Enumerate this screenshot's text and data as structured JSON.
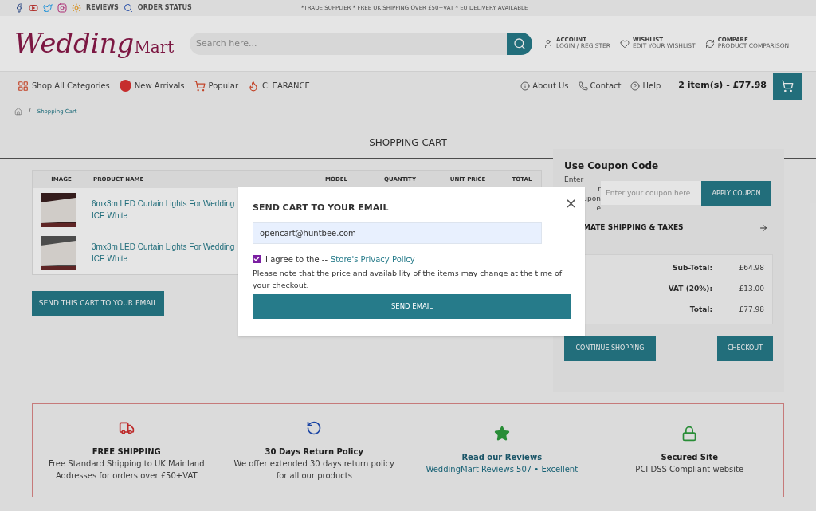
{
  "top_bar": {
    "links": [
      "REVIEWS",
      "ORDER STATUS"
    ],
    "notice": "*TRADE SUPPLIER * FREE UK SHIPPING OVER £50+VAT * EU DELIVERY AVAILABLE"
  },
  "header": {
    "logo": {
      "script": "Wedding",
      "word": "Mart"
    },
    "search": {
      "placeholder": "Search here..."
    },
    "account_links": [
      {
        "title": "ACCOUNT",
        "subtitle": "LOGIN / REGISTER"
      },
      {
        "title": "WISHLIST",
        "subtitle": "EDIT YOUR WISHLIST"
      },
      {
        "title": "COMPARE",
        "subtitle": "PRODUCT COMPARISON"
      }
    ]
  },
  "nav": {
    "items": [
      "Shop All Categories",
      "New Arrivals",
      "Popular",
      "CLEARANCE"
    ],
    "right_items": [
      "About Us",
      "Contact",
      "Help"
    ],
    "cart": "2 item(s) - £77.98"
  },
  "breadcrumb": {
    "separator": "/",
    "items": [
      "Shopping Cart"
    ]
  },
  "page_title": "SHOPPING CART",
  "cart_table": {
    "columns": [
      "IMAGE",
      "PRODUCT NAME",
      "MODEL",
      "QUANTITY",
      "UNIT PRICE",
      "TOTAL"
    ],
    "rows": [
      {
        "name": [
          "6mx3m LED Curtain Lights For Wedding",
          "ICE White"
        ]
      },
      {
        "name": [
          "3mx3m LED Curtain Lights For Wedding",
          "ICE White"
        ]
      }
    ]
  },
  "send_cart_button": "SEND THIS CART TO YOUR EMAIL",
  "coupon": {
    "title": "Use Coupon Code",
    "label_lines": [
      "Enter",
      "r",
      "upon",
      "e"
    ],
    "placeholder": "Enter your coupon here",
    "button": "APPLY COUPON"
  },
  "shipping": {
    "title": "MATE SHIPPING & TAXES"
  },
  "totals": [
    {
      "label": "Sub-Total:",
      "value": "£64.98"
    },
    {
      "label": "VAT (20%):",
      "value": "£13.00"
    },
    {
      "label": "Total:",
      "value": "£77.98"
    }
  ],
  "actions": [
    "CONTINUE SHOPPING",
    "CHECKOUT"
  ],
  "features": [
    {
      "kind": "truck",
      "title": "FREE SHIPPING",
      "text": "Free Standard Shipping to UK Mainland Addresses for orders over £50+VAT"
    },
    {
      "kind": "return",
      "title": "30 Days Return Policy",
      "text": "We offer extended 30 days return policy for all our products"
    },
    {
      "kind": "star",
      "title": "Read our Reviews",
      "text": "WeddingMart Reviews 507 • Excellent"
    },
    {
      "kind": "lock",
      "title": "Secured Site",
      "text": "PCI DSS Compliant website"
    }
  ],
  "modal": {
    "title": "SEND CART TO YOUR EMAIL",
    "email": "opencart@huntbee.com",
    "agree": {
      "checked": true,
      "text": "I agree to the --",
      "link": "Store's Privacy Policy"
    },
    "note": "Please note that the price and availability of the items may change at the time of your checkout.",
    "button": "SEND EMAIL",
    "close": "×"
  }
}
